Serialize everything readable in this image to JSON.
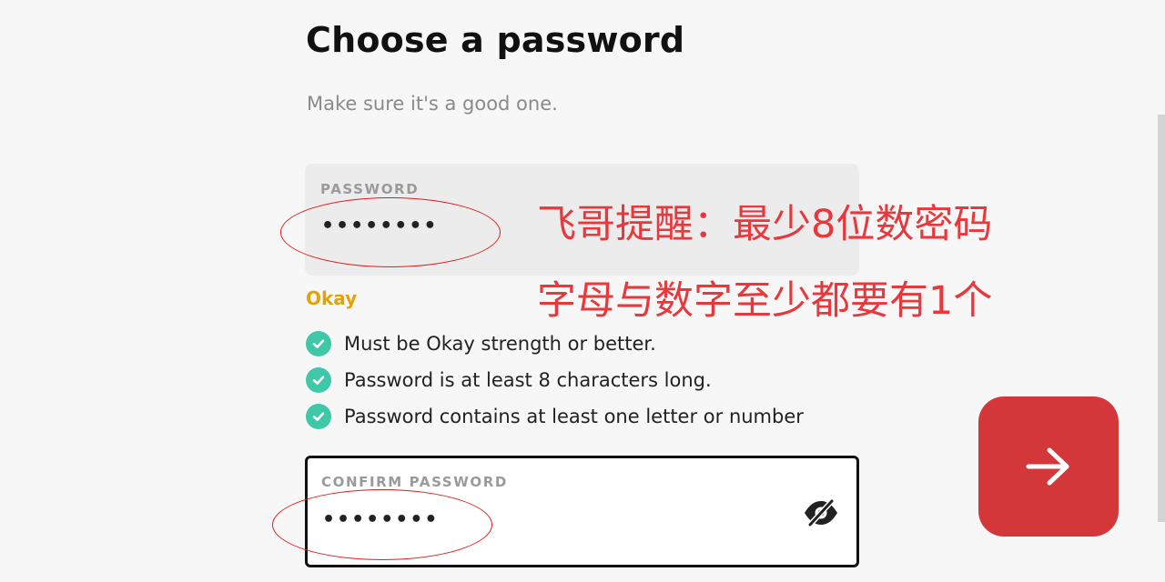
{
  "page": {
    "title": "Choose a password",
    "subtitle": "Make sure it's a good one."
  },
  "password_field": {
    "label": "PASSWORD",
    "value": "••••••••"
  },
  "strength": {
    "label": "Okay",
    "color": "#e0a30e"
  },
  "requirements": [
    {
      "text": "Must be Okay strength or better.",
      "met": true
    },
    {
      "text": "Password is at least 8 characters long.",
      "met": true
    },
    {
      "text": "Password contains at least one letter or number",
      "met": true
    }
  ],
  "confirm_field": {
    "label": "CONFIRM PASSWORD",
    "value": "••••••••",
    "toggle_icon": "eye-slash-icon"
  },
  "next_button": {
    "icon": "arrow-right-icon",
    "color": "#d3373a"
  },
  "annotations": {
    "line1": "飞哥提醒：最少8位数密码",
    "line2": "字母与数字至少都要有1个",
    "color": "#e8383b"
  },
  "colors": {
    "check": "#3ec8a8",
    "background": "#f7f7f7"
  }
}
